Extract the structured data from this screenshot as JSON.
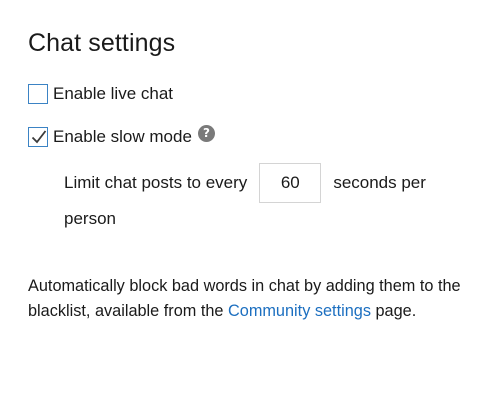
{
  "title": "Chat settings",
  "options": {
    "live_chat": {
      "label": "Enable live chat",
      "checked": false
    },
    "slow_mode": {
      "label": "Enable slow mode",
      "checked": true,
      "help_glyph": "?"
    }
  },
  "slow_mode_limit": {
    "prefix": "Limit chat posts to every",
    "value": "60",
    "suffix_line1": "seconds per",
    "suffix_line2": "person"
  },
  "description": {
    "text_before": "Automatically block bad words in chat by adding them to the blacklist, available from the ",
    "link_text": "Community settings",
    "text_after": " page."
  },
  "colors": {
    "accent": "#3b83c4",
    "link": "#1c6fc0",
    "help_icon_bg": "#7a7a7a"
  },
  "icons": [
    "checkbox-icon",
    "checkmark-icon",
    "help-icon"
  ]
}
